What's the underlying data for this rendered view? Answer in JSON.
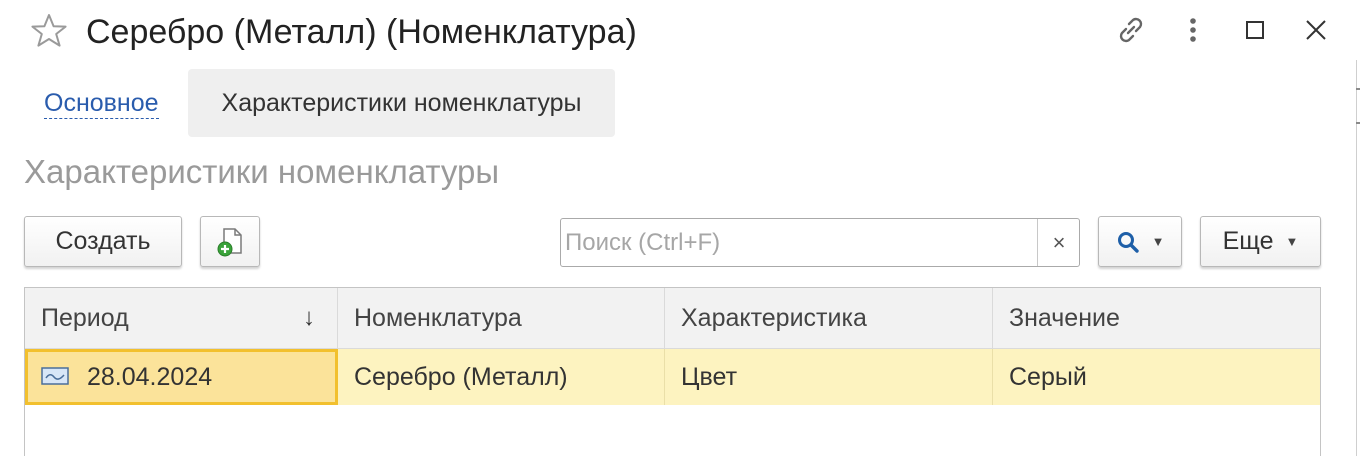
{
  "window": {
    "title": "Серебро (Металл) (Номенклатура)",
    "icons": [
      "star-icon",
      "link-icon",
      "more-vertical-icon",
      "maximize-icon",
      "close-icon"
    ]
  },
  "tabs": [
    {
      "label": "Основное",
      "active": false
    },
    {
      "label": "Характеристики номенклатуры",
      "active": true
    }
  ],
  "section": {
    "title": "Характеристики номенклатуры"
  },
  "toolbar": {
    "create_label": "Создать",
    "copy_icon": "add-document-icon",
    "search": {
      "placeholder": "Поиск (Ctrl+F)",
      "value": "",
      "clear_label": "×"
    },
    "search_button_icon": "magnifier-icon",
    "more_label": "Еще"
  },
  "table": {
    "columns": [
      "Период",
      "Номенклатура",
      "Характеристика",
      "Значение"
    ],
    "sort_indicator": "↓",
    "rows": [
      {
        "period": "28.04.2024",
        "nomenclature": "Серебро (Металл)",
        "characteristic": "Цвет",
        "value": "Серый"
      }
    ]
  },
  "colors": {
    "accent_link": "#2a5cad",
    "selected_row": "#fdf3c0",
    "current_cell_border": "#f2c02e"
  }
}
